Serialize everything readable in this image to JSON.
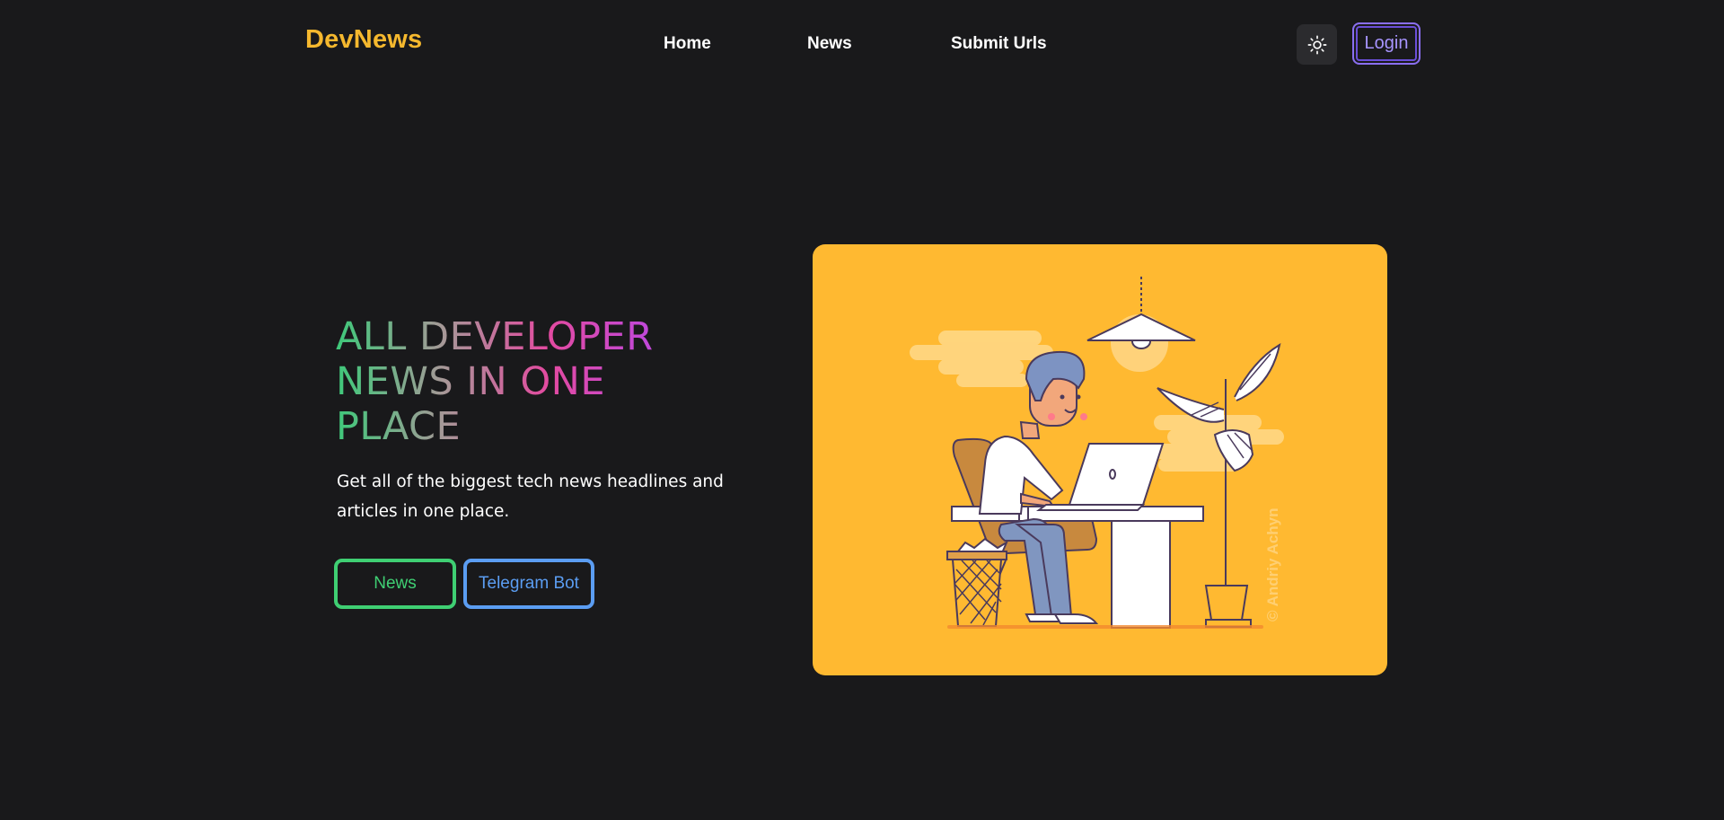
{
  "header": {
    "brand": "DevNews",
    "nav": [
      {
        "label": "Home"
      },
      {
        "label": "News"
      },
      {
        "label": "Submit Urls"
      }
    ],
    "theme_toggle_icon": "sun-icon",
    "login_label": "Login"
  },
  "hero": {
    "title": "ALL DEVELOPER NEWS IN ONE PLACE",
    "subtitle": "Get all of the biggest tech news headlines and articles in one place.",
    "buttons": [
      {
        "label": "News"
      },
      {
        "label": "Telegram Bot"
      }
    ]
  },
  "illustration": {
    "subject": "developer-at-desk-illustration",
    "watermark": "© Andriy Achyn"
  },
  "colors": {
    "background": "#19191b",
    "brand": "#f5b82e",
    "login_accent": "#8a6ff0",
    "news_button": "#3fcf73",
    "telegram_button": "#5b9df2",
    "illustration_bg": "#ffb931"
  }
}
